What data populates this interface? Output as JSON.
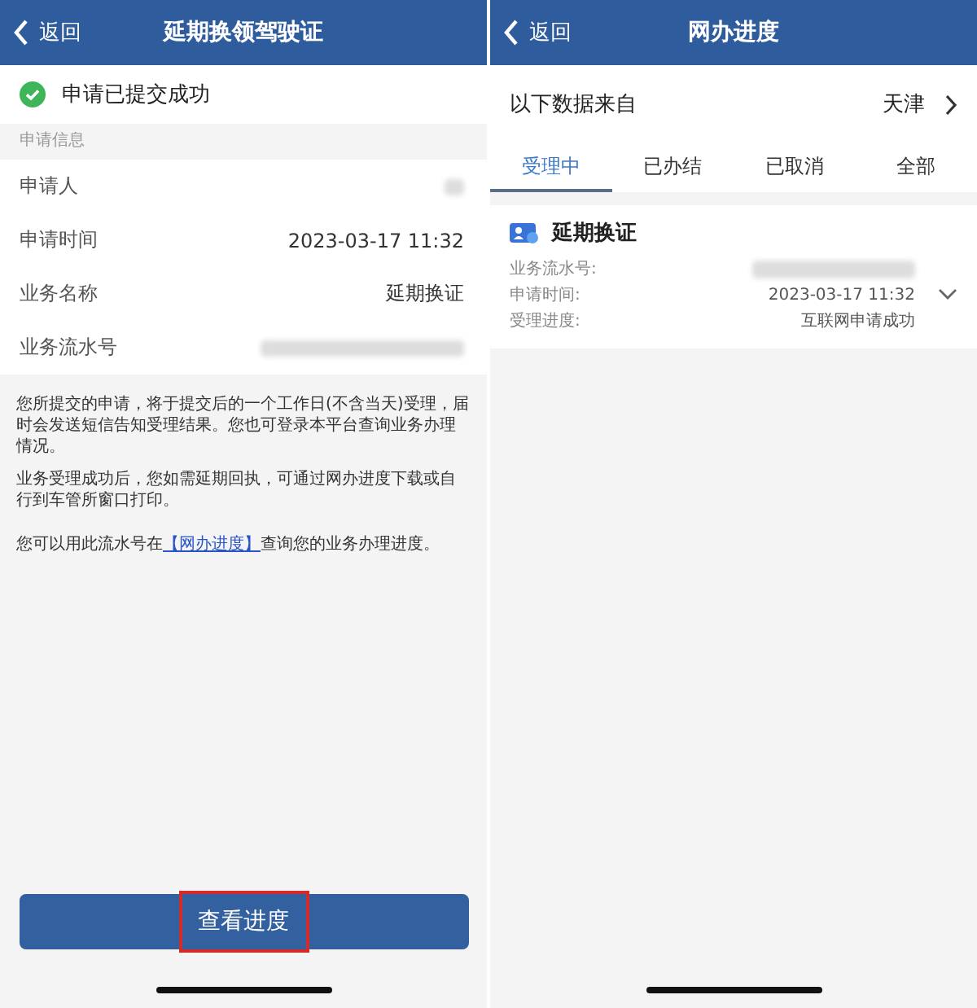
{
  "left_screen": {
    "nav": {
      "back": "返回",
      "title": "延期换领驾驶证"
    },
    "status": {
      "text": "申请已提交成功",
      "success": true
    },
    "section_label": "申请信息",
    "fields": [
      {
        "label": "申请人",
        "kind": "redacted"
      },
      {
        "label": "申请时间",
        "kind": "text",
        "value": "2023-03-17 11:32"
      },
      {
        "label": "业务名称",
        "kind": "text",
        "value": "延期换证"
      },
      {
        "label": "业务流水号",
        "kind": "redacted"
      }
    ],
    "notes": [
      "您所提交的申请，将于提交后的一个工作日(不含当天)受理，届时会发送短信告知受理结果。您也可登录本平台查询业务办理情况。",
      "业务受理成功后，您如需延期回执，可通过网办进度下载或自行到车管所窗口打印。"
    ],
    "link_note": {
      "before": "您可以用此流水号在",
      "link": "【网办进度】",
      "after": "查询您的业务办理进度。"
    },
    "button": {
      "label": "查看进度",
      "highlighted": true
    }
  },
  "right_screen": {
    "nav": {
      "back": "返回",
      "title": "网办进度"
    },
    "source": {
      "label": "以下数据来自",
      "value": "天津"
    },
    "tabs": [
      {
        "label": "受理中",
        "selected": true
      },
      {
        "label": "已办结",
        "selected": false
      },
      {
        "label": "已取消",
        "selected": false
      },
      {
        "label": "全部",
        "selected": false
      }
    ],
    "card": {
      "title": "延期换证",
      "expanded": false,
      "rows": [
        {
          "label": "业务流水号:",
          "kind": "redacted"
        },
        {
          "label": "申请时间:",
          "kind": "text",
          "value": "2023-03-17 11:32"
        },
        {
          "label": "受理进度:",
          "kind": "text",
          "value": "互联网申请成功"
        }
      ]
    }
  }
}
